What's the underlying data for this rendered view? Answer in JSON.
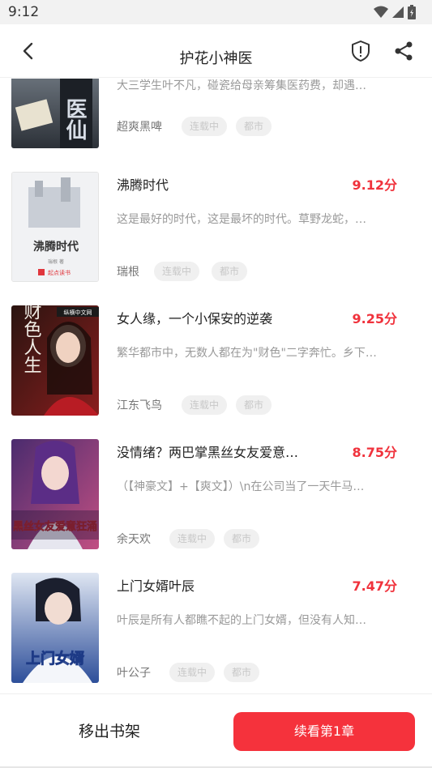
{
  "status_bar": {
    "time": "9:12"
  },
  "header": {
    "title": "护花小神医"
  },
  "books": [
    {
      "title": "",
      "score": "",
      "description": "大三学生叶不凡，碰瓷给母亲筹集医药费，却遇…",
      "author": "超爽黑啤",
      "status_tag": "连载中",
      "genre_tag": "都市",
      "cover_text": "医仙",
      "cover_colors": [
        "#6f7a84",
        "#2c3138"
      ]
    },
    {
      "title": "沸腾时代",
      "score": "9.12分",
      "description": "这是最好的时代，这是最坏的时代。草野龙蛇，…",
      "author": "瑞根",
      "status_tag": "连载中",
      "genre_tag": "都市",
      "cover_text": "沸腾时代",
      "cover_sub": "瑞根 著",
      "cover_brand": "起点读书",
      "cover_colors": [
        "#f3f4f6",
        "#e7e9ec"
      ]
    },
    {
      "title": "女人缘，一个小保安的逆袭",
      "score": "9.25分",
      "description": "繁华都市中，无数人都在为\"财色\"二字奔忙。乡下…",
      "author": "江东飞鸟",
      "status_tag": "连载中",
      "genre_tag": "都市",
      "cover_text": "财色人生",
      "cover_brand": "纵横中文网",
      "cover_colors": [
        "#2a1410",
        "#8a1e1e"
      ]
    },
    {
      "title": "没情绪？两巴掌黑丝女友爱意…",
      "score": "8.75分",
      "description": "（【神豪文】+【爽文】）\\n在公司当了一天牛马…",
      "author": "余天欢",
      "status_tag": "连载中",
      "genre_tag": "都市",
      "cover_text": "黑丝女友爱意狂涌",
      "cover_colors": [
        "#4a2b6e",
        "#c14f82"
      ]
    },
    {
      "title": "上门女婿叶辰",
      "score": "7.47分",
      "description": "叶辰是所有人都瞧不起的上门女婿，但没有人知…",
      "author": "叶公子",
      "status_tag": "连载中",
      "genre_tag": "都市",
      "cover_text": "上门女婿",
      "cover_colors": [
        "#b8c8e4",
        "#2e4f9a"
      ]
    }
  ],
  "bottom": {
    "remove_label": "移出书架",
    "continue_label": "续看第1章"
  },
  "colors": {
    "accent": "#f5323c",
    "score": "#f0323c",
    "tag_bg": "#f0f0f0",
    "tag_text": "#c8c8c8"
  }
}
